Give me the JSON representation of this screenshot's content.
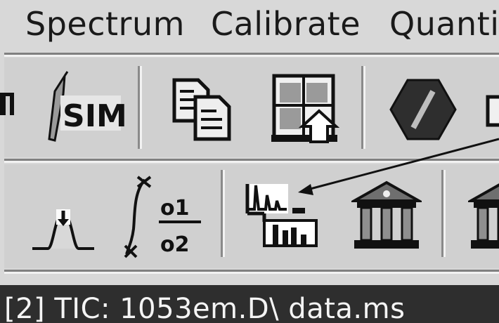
{
  "menu": {
    "items": [
      "Spectrum",
      "Calibrate",
      "Quantif"
    ]
  },
  "toolbar1": {
    "tools": [
      {
        "icon": "pen-sim-icon",
        "label": "SIM"
      },
      {
        "icon": "copy-icon"
      },
      {
        "icon": "grid-export-icon"
      },
      {
        "icon": "stop-hexagon-icon"
      }
    ]
  },
  "toolbar2": {
    "tools": [
      {
        "icon": "peak-down-arrow-icon"
      },
      {
        "icon": "ratio-icon",
        "labels": [
          "o1",
          "o2"
        ]
      },
      {
        "icon": "chromatogram-spectrum-icon"
      },
      {
        "icon": "library-icon"
      },
      {
        "icon": "library-icon"
      }
    ]
  },
  "window": {
    "title": "[2] TIC: 1053em.D\\ data.ms"
  }
}
